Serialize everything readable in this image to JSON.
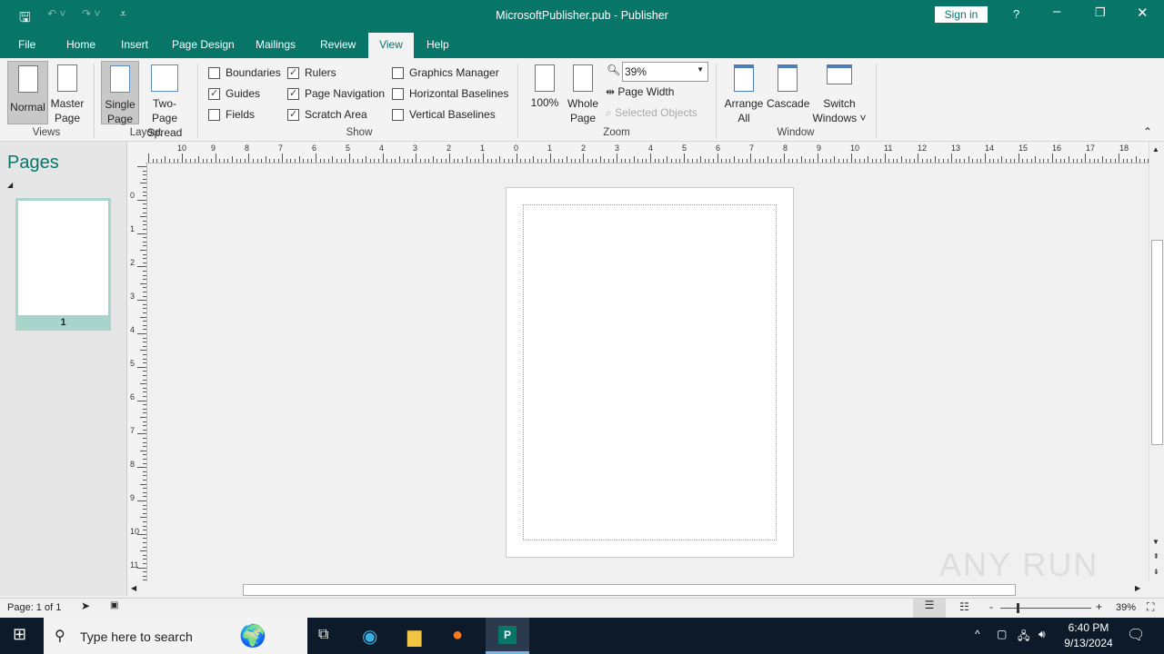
{
  "title": "MicrosoftPublisher.pub  -  Publisher",
  "signin": "Sign in",
  "help": "?",
  "tabs": [
    "File",
    "Home",
    "Insert",
    "Page Design",
    "Mailings",
    "Review",
    "View",
    "Help"
  ],
  "views": {
    "normal": "Normal",
    "master": [
      "Master",
      "Page"
    ],
    "label": "Views"
  },
  "layout": {
    "single": [
      "Single",
      "Page"
    ],
    "two": [
      "Two-Page",
      "Spread"
    ],
    "label": "Layout"
  },
  "show": {
    "label": "Show",
    "items": [
      {
        "label": "Boundaries",
        "checked": false
      },
      {
        "label": "Guides",
        "checked": true
      },
      {
        "label": "Fields",
        "checked": false
      },
      {
        "label": "Rulers",
        "checked": true
      },
      {
        "label": "Page Navigation",
        "checked": true
      },
      {
        "label": "Scratch Area",
        "checked": true
      },
      {
        "label": "Graphics Manager",
        "checked": false
      },
      {
        "label": "Horizontal Baselines",
        "checked": false
      },
      {
        "label": "Vertical Baselines",
        "checked": false
      }
    ]
  },
  "zoom": {
    "label": "Zoom",
    "p100": "100%",
    "whole": [
      "Whole",
      "Page"
    ],
    "value": "39%",
    "page_width": "Page Width",
    "selected": "Selected Objects"
  },
  "window": {
    "label": "Window",
    "arrange": [
      "Arrange",
      "All"
    ],
    "cascade": "Cascade",
    "switch": [
      "Switch",
      "Windows ˅"
    ]
  },
  "pages": {
    "title": "Pages",
    "thumb": "1"
  },
  "ruler_h": [
    "10",
    "9",
    "8",
    "7",
    "6",
    "5",
    "4",
    "3",
    "2",
    "1",
    "0",
    "1",
    "2",
    "3",
    "4",
    "5",
    "6",
    "7",
    "8",
    "9",
    "10",
    "11",
    "12",
    "13",
    "14",
    "15",
    "16",
    "17",
    "18"
  ],
  "ruler_v": [
    "0",
    "1",
    "2",
    "3",
    "4",
    "5",
    "6",
    "7",
    "8",
    "9",
    "10",
    "11"
  ],
  "status": {
    "page": "Page: 1 of 1",
    "zoom": "39%",
    "zoom_fraction": 0.39
  },
  "taskbar": {
    "search": "Type here to search",
    "time": "6:40 PM",
    "date": "9/13/2024"
  },
  "watermark": "ANY RUN"
}
